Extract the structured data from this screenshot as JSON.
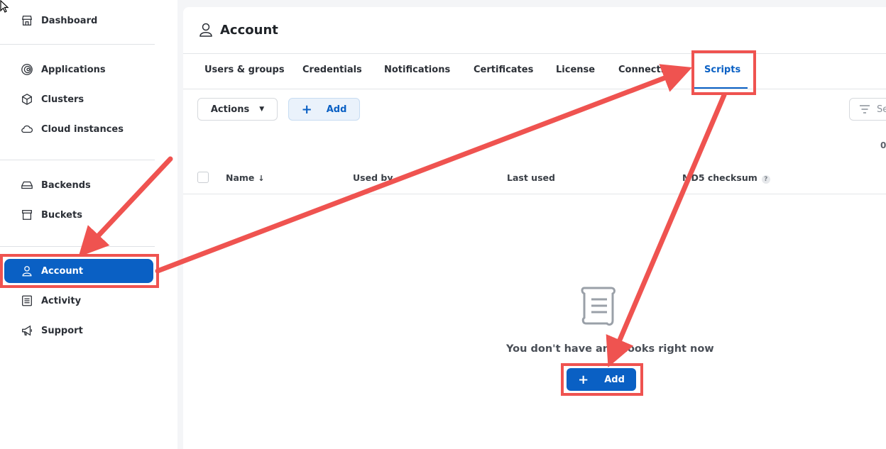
{
  "sidebar": {
    "items": [
      {
        "label": "Dashboard",
        "icon": "storefront-icon"
      },
      {
        "label": "Applications",
        "icon": "target-rings-icon"
      },
      {
        "label": "Clusters",
        "icon": "cube-icon"
      },
      {
        "label": "Cloud instances",
        "icon": "cloud-icon"
      },
      {
        "label": "Backends",
        "icon": "drive-icon"
      },
      {
        "label": "Buckets",
        "icon": "bucket-box-icon"
      },
      {
        "label": "Account",
        "icon": "user-icon",
        "active": true
      },
      {
        "label": "Activity",
        "icon": "list-doc-icon"
      },
      {
        "label": "Support",
        "icon": "megaphone-icon"
      }
    ]
  },
  "page": {
    "title": "Account",
    "title_icon": "user-icon"
  },
  "tabs": [
    {
      "label": "Users & groups"
    },
    {
      "label": "Credentials"
    },
    {
      "label": "Notifications"
    },
    {
      "label": "Certificates"
    },
    {
      "label": "License"
    },
    {
      "label": "Connections"
    },
    {
      "label": "Scripts",
      "active": true
    }
  ],
  "toolbar": {
    "actions_label": "Actions",
    "add_label": "Add",
    "filter_placeholder": "Se",
    "count": "0"
  },
  "table": {
    "columns": [
      "Name",
      "Used by",
      "Last used",
      "MD5 checksum"
    ],
    "sort_indicator": "↓",
    "help_icon": "?"
  },
  "empty_state": {
    "message": "You don't have any hooks right now",
    "add_label": "Add",
    "icon": "scroll-icon"
  },
  "colors": {
    "accent": "#0a60c4",
    "annotation": "#ef5350"
  }
}
